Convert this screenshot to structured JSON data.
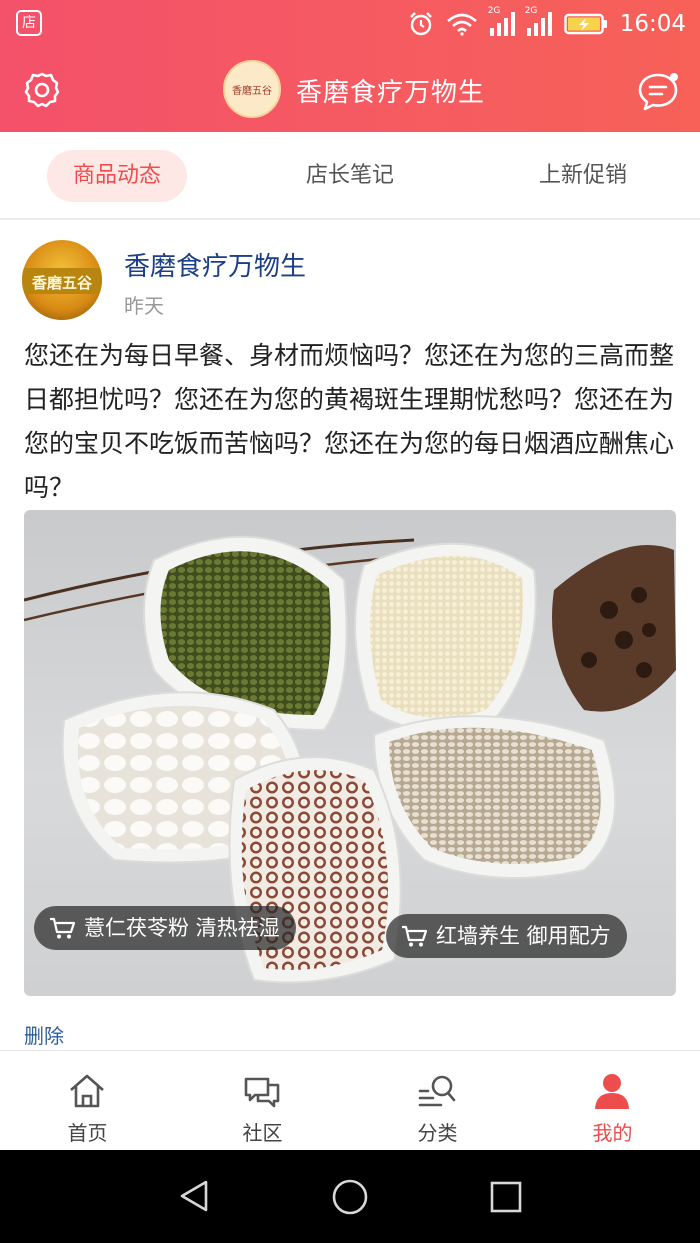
{
  "status_bar": {
    "shop_icon_label": "店",
    "network_1": "2G",
    "network_2": "2G",
    "time": "16:04"
  },
  "header": {
    "title": "香磨食疗万物生",
    "logo_text": "香磨五谷"
  },
  "tabs": [
    {
      "label": "商品动态",
      "active": true
    },
    {
      "label": "店长笔记",
      "active": false
    },
    {
      "label": "上新促销",
      "active": false
    }
  ],
  "post": {
    "author": "香磨食疗万物生",
    "avatar_text": "香磨五谷",
    "time": "昨天",
    "text": "您还在为每日早餐、身材而烦恼吗？您还在为您的三高而整日都担忧吗？您还在为您的黄褐斑生理期忧愁吗？您还在为您的宝贝不吃饭而苦恼吗？您还在为您的每日烟酒应酬焦心吗？",
    "product_tags": [
      {
        "label": "薏仁茯苓粉 清热祛湿"
      },
      {
        "label": "红墙养生 御用配方"
      }
    ],
    "delete_label": "删除"
  },
  "bottom_nav": [
    {
      "label": "首页",
      "icon": "home-icon",
      "active": false
    },
    {
      "label": "社区",
      "icon": "community-icon",
      "active": false
    },
    {
      "label": "分类",
      "icon": "category-search-icon",
      "active": false
    },
    {
      "label": "我的",
      "icon": "profile-icon",
      "active": true
    }
  ],
  "colors": {
    "accent": "#ee4d4d",
    "header_gradient_start": "#f4516a",
    "header_gradient_end": "#f76158",
    "author": "#1d3f86",
    "link": "#2e5f9a"
  }
}
